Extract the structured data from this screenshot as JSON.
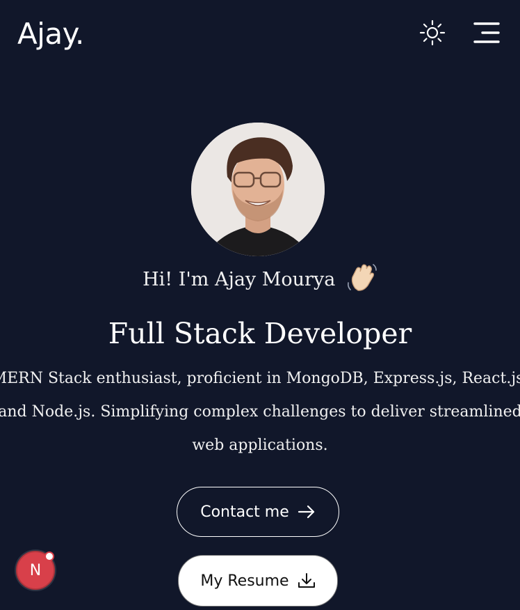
{
  "header": {
    "logo": "Ajay.",
    "theme_icon": "sun-icon",
    "menu_icon": "menu-icon"
  },
  "hero": {
    "greeting": "Hi! I'm Ajay Mourya",
    "wave_icon": "waving-hand-icon",
    "headline": "Full Stack Developer",
    "intro": "MERN Stack enthusiast, proficient in MongoDB, Express.js, React.js, and Node.js. Simplifying complex challenges to deliver streamlined web applications."
  },
  "actions": {
    "contact_label": "Contact me",
    "contact_icon": "arrow-right-icon",
    "resume_label": "My Resume",
    "resume_icon": "download-icon"
  },
  "dev_badge": {
    "label": "N"
  },
  "colors": {
    "background": "#11172a",
    "text": "#ffffff",
    "badge": "#d8404a"
  }
}
